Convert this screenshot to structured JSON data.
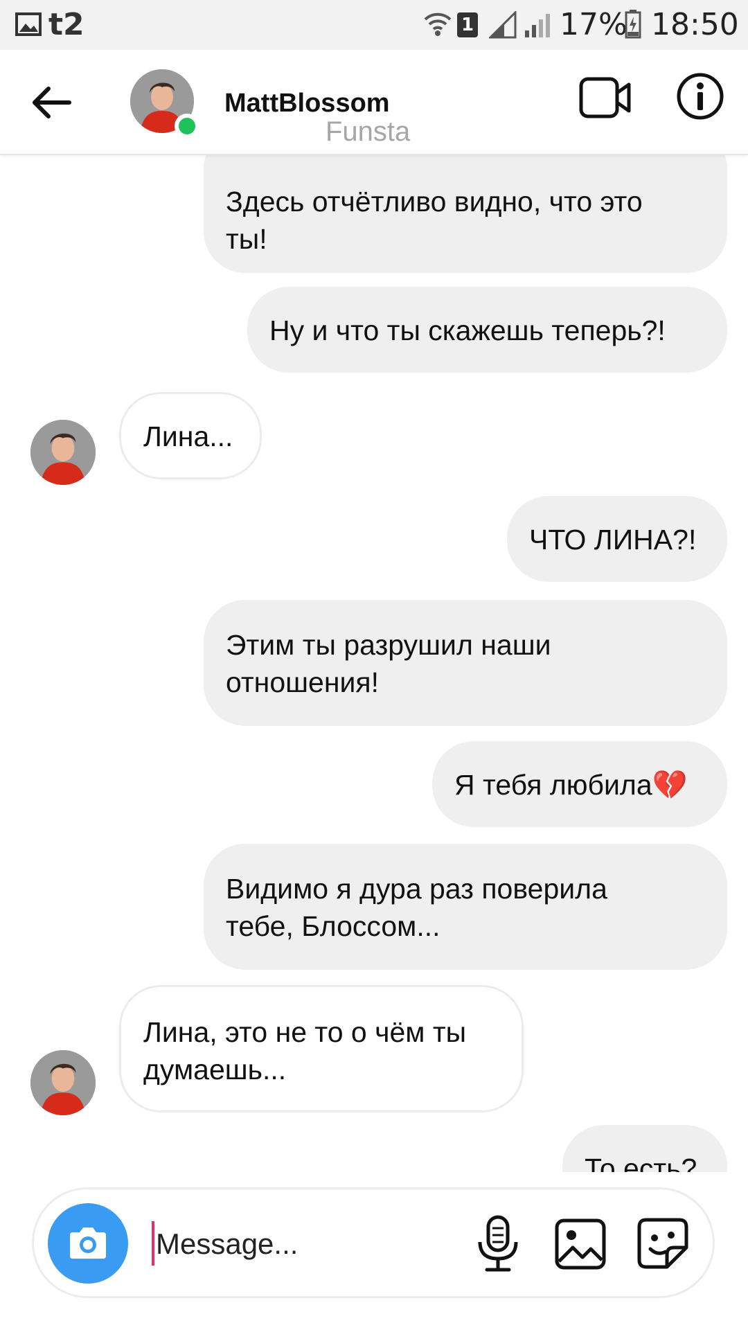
{
  "status_bar": {
    "carrier": "t2",
    "sim_slot": "1",
    "battery": "17%",
    "time": "18:50"
  },
  "header": {
    "username": "MattBlossom",
    "subtitle": "Funsta",
    "online_color": "#1ec25a"
  },
  "messages": [
    {
      "side": "out",
      "text": "Здесь отчётливо видно, что это ты!",
      "line1": "Здесь отчётливо видно, что это",
      "line2": "ты!"
    },
    {
      "side": "out",
      "text": "Ну и что ты скажешь теперь?!"
    },
    {
      "side": "in",
      "text": "Лина..."
    },
    {
      "side": "out",
      "text": "ЧТО ЛИНА?!"
    },
    {
      "side": "out",
      "text": "Этим ты разрушил наши отношения!",
      "line1": "Этим ты разрушил наши",
      "line2": "отношения!"
    },
    {
      "side": "out",
      "text": "Я тебя любила💔"
    },
    {
      "side": "out",
      "text": "Видимо я дура раз поверила тебе, Блоссом...",
      "line1": "Видимо я дура раз поверила",
      "line2": "тебе, Блоссом..."
    },
    {
      "side": "in",
      "text": "Лина, это не то о чём ты думаешь...",
      "line1": "Лина, это не то о чём ты",
      "line2": "думаешь..."
    },
    {
      "side": "out",
      "text": "То есть?"
    }
  ],
  "composer": {
    "placeholder": "Message..."
  },
  "icons": {
    "back": "arrow-left-icon",
    "video": "video-camera-icon",
    "info": "info-icon",
    "camera": "camera-icon",
    "mic": "microphone-icon",
    "gallery": "image-icon",
    "sticker": "sticker-icon"
  },
  "colors": {
    "accent": "#3a9bf2",
    "cursor": "#e0306b",
    "outgoing_bubble": "#efefef"
  }
}
